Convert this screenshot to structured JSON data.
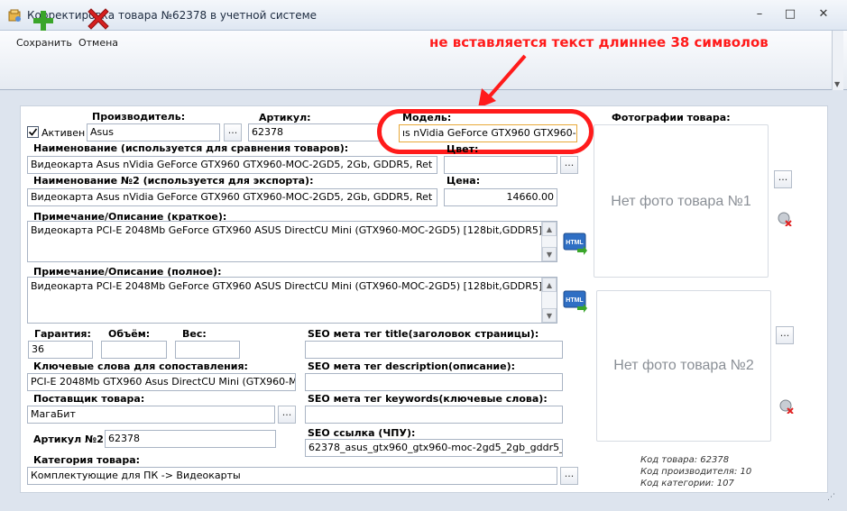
{
  "window": {
    "title": "Корректировка товара №62378 в учетной системе",
    "controls": {
      "minimize": "–",
      "maximize": "□",
      "close": "✕"
    }
  },
  "toolbar": {
    "save_label": "Сохранить",
    "cancel_label": "Отмена"
  },
  "annotation": "не вставляется текст длиннее 38 символов",
  "form": {
    "active_label": "Активен",
    "active_checked": true,
    "manufacturer": {
      "label": "Производитель:",
      "value": "Asus"
    },
    "article": {
      "label": "Артикул:",
      "value": "62378"
    },
    "model": {
      "label": "Модель:",
      "value": "ıs nVidia GeForce GTX960 GTX960-MOC-"
    },
    "name": {
      "label": "Наименование (используется для сравнения товаров):",
      "value": "Видеокарта Asus nVidia GeForce GTX960 GTX960-MOC-2GD5, 2Gb, GDDR5, Ret"
    },
    "color": {
      "label": "Цвет:",
      "value": ""
    },
    "name2": {
      "label": "Наименование №2 (используется для экспорта):",
      "value": "Видеокарта Asus nVidia GeForce GTX960 GTX960-MOC-2GD5, 2Gb, GDDR5, Ret"
    },
    "price": {
      "label": "Цена:",
      "value": "14660.00"
    },
    "short_desc": {
      "label": "Примечание/Описание (краткое):",
      "value": "Видеокарта PCI-E 2048Mb GeForce GTX960 ASUS DirectCU Mini (GTX960-MOC-2GD5) [128bit,GDDR5] RTL"
    },
    "full_desc": {
      "label": "Примечание/Описание (полное):",
      "value": "Видеокарта PCI-E 2048Mb GeForce GTX960 ASUS DirectCU Mini (GTX960-MOC-2GD5) [128bit,GDDR5] RTL"
    },
    "warranty": {
      "label": "Гарантия:",
      "value": "36"
    },
    "volume": {
      "label": "Объём:",
      "value": ""
    },
    "weight": {
      "label": "Вес:",
      "value": ""
    },
    "keywords_match": {
      "label": "Ключевые слова для сопоставления:",
      "value": "PCI-E 2048Mb  GTX960 Asus DirectCU Mini (GTX960-MOC-2GI"
    },
    "supplier": {
      "label": "Поставщик товара:",
      "value": "МагаБит"
    },
    "article2": {
      "label": "Артикул №2:",
      "value": "62378"
    },
    "category": {
      "label": "Категория товара:",
      "value": "Комплектующие для ПК -> Видеокарты"
    },
    "seo_title": {
      "label": "SEO мета тег title(заголовок страницы):",
      "value": ""
    },
    "seo_description": {
      "label": "SEO мета тег description(описание):",
      "value": ""
    },
    "seo_keywords": {
      "label": "SEO мета тег keywords(ключевые слова):",
      "value": ""
    },
    "seo_link": {
      "label": "SEO ссылка (ЧПУ):",
      "value": "62378_asus_gtx960_gtx960-moc-2gd5_2gb_gddr5_ret"
    },
    "ellipsis": "...",
    "html_label": "HTML"
  },
  "photos": {
    "label": "Фотографии товара:",
    "photo1": "Нет фото товара №1",
    "photo2": "Нет фото товара №2"
  },
  "info": {
    "product_code": "Код товара: 62378",
    "manufacturer_code": "Код производителя: 10",
    "category_code": "Код категории: 107"
  },
  "colors": {
    "accent_red": "#ff1b1b",
    "save_green": "#3aa52a",
    "cancel_red": "#d62020"
  }
}
